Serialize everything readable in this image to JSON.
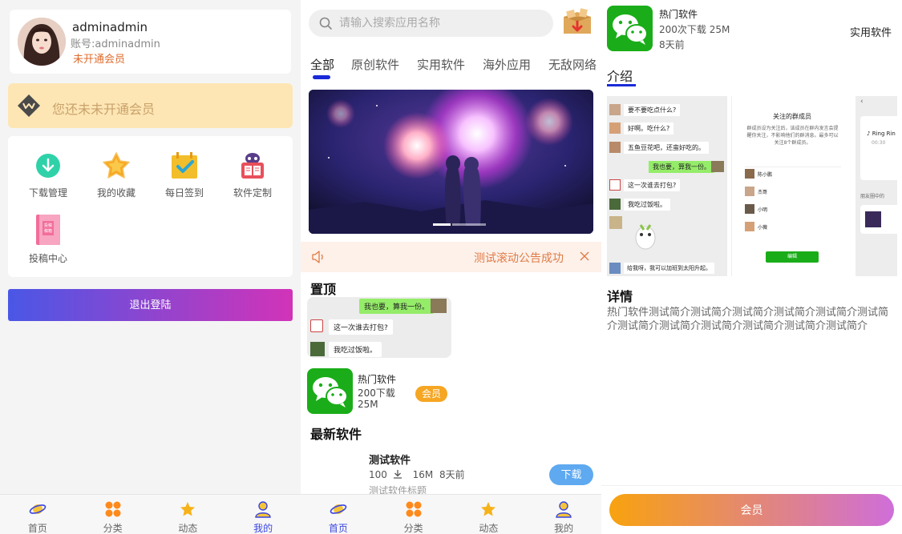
{
  "profile": {
    "username": "adminadmin",
    "account": "账号:adminadmin",
    "status": "未开通会员",
    "vip_banner": "您还未未开通会员",
    "menu": [
      {
        "label": "下载管理",
        "icon": "download-icon"
      },
      {
        "label": "我的收藏",
        "icon": "star-icon"
      },
      {
        "label": "每日签到",
        "icon": "calendar-check-icon"
      },
      {
        "label": "软件定制",
        "icon": "robot-book-icon"
      },
      {
        "label": "投稿中心",
        "icon": "submit-book-icon"
      }
    ],
    "logout": "退出登陆",
    "tabs": [
      "首页",
      "分类",
      "动态",
      "我的"
    ],
    "active_tab": "我的"
  },
  "home": {
    "search_placeholder": "请输入搜索应用名称",
    "categories": [
      "全部",
      "原创软件",
      "实用软件",
      "海外应用",
      "无敌网络"
    ],
    "active_category": "全部",
    "notice": "测试滚动公告成功",
    "pinned_title": "置顶",
    "pinned_chat": [
      "我也要，算我一份。",
      "这一次谁去打包?",
      "我吃过饭啦。"
    ],
    "pinned_app": {
      "name": "热门软件",
      "downloads": "200下载",
      "size": "25M",
      "badge": "会员"
    },
    "latest_title": "最新软件",
    "latest_app": {
      "name": "测试软件",
      "downloads": "100",
      "size": "16M",
      "time": "8天前",
      "subtitle": "测试软件标题",
      "button": "下载"
    },
    "tabs": [
      "首页",
      "分类",
      "动态",
      "我的"
    ],
    "active_tab": "首页"
  },
  "detail": {
    "name": "热门软件",
    "downloads_size": "200次下载  25M",
    "time": "8天前",
    "category": "实用软件",
    "tab": "介绍",
    "details_title": "详情",
    "details_body": "热门软件测试简介测试简介测试简介测试简介测试简介测试简介测试简介测试简介测试简介测试简介测试简介测试简介",
    "cta": "会员",
    "shot1_chat": [
      "要不要吃点什么?",
      "好啊。吃什么?",
      "五鱼豆花吧，还蛮好吃的。",
      "我也要，算我一份。",
      "这一次谁去打包?",
      "我吃过饭啦。",
      "给我呀，我可以加班到太阳升起。"
    ],
    "shot2": {
      "title": "关注的群成员",
      "desc": "群成员设为关注后，该成员在群内发言会提醒你关注，不影响他们的群消息。最多可以关注8个群成员。",
      "members": [
        "陈小鹏",
        "杰哥",
        "小明",
        "小薇"
      ],
      "button": "编辑"
    },
    "shot3": {
      "song": "♪ Ring Rin",
      "time": "00:30",
      "label": "朋友圈中的"
    }
  },
  "colors": {
    "accent": "#1a2ad8",
    "wechat_green": "#1aad19",
    "vip_orange": "#f5a623",
    "notice_text": "#e07b45"
  }
}
